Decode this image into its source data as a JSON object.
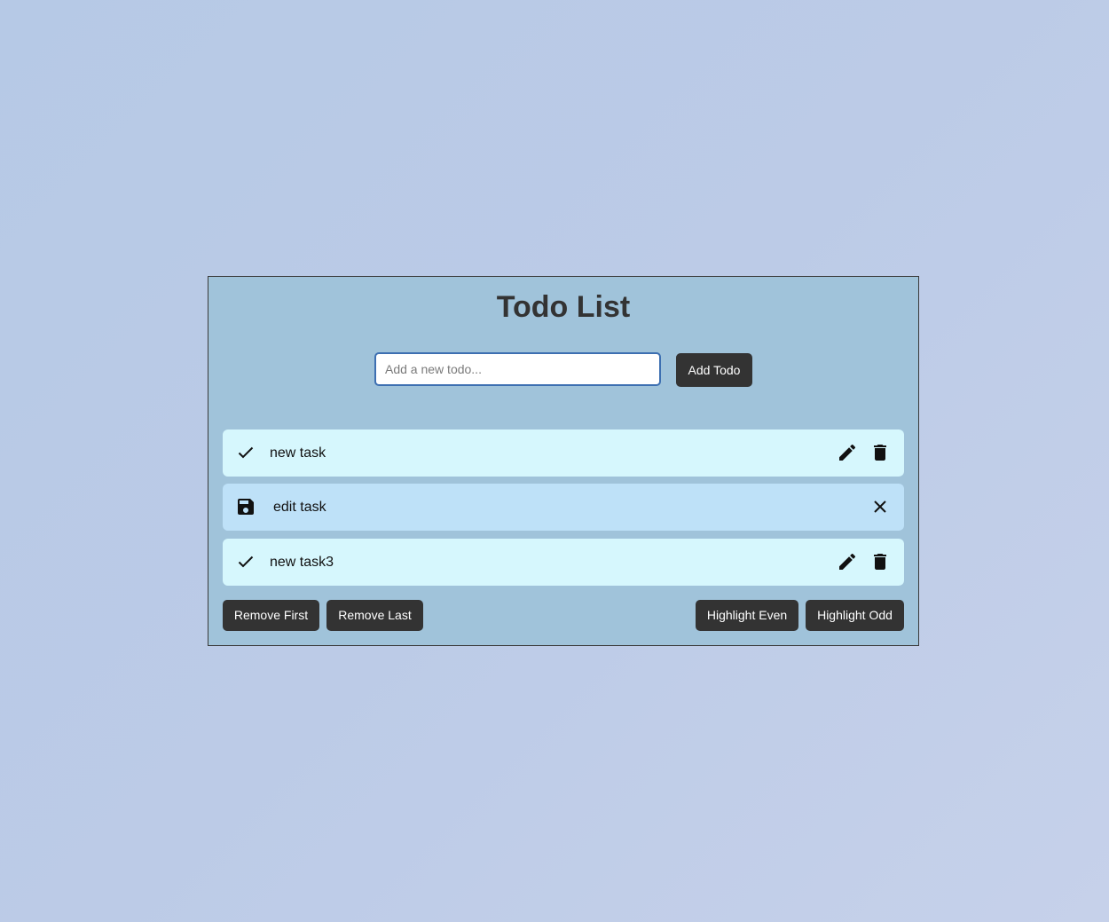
{
  "app": {
    "title": "Todo List"
  },
  "new_todo": {
    "placeholder": "Add a new todo...",
    "value": "",
    "add_label": "Add Todo"
  },
  "todos": [
    {
      "text": "new task",
      "mode": "view",
      "icons": [
        "check-icon",
        "pencil-icon",
        "trash-icon"
      ]
    },
    {
      "text": "edit task",
      "mode": "edit",
      "icons": [
        "save-icon",
        "close-icon"
      ]
    },
    {
      "text": "new task3",
      "mode": "view",
      "icons": [
        "check-icon",
        "pencil-icon",
        "trash-icon"
      ]
    }
  ],
  "actions": {
    "remove_first": "Remove First",
    "remove_last": "Remove Last",
    "highlight_even": "Highlight Even",
    "highlight_odd": "Highlight Odd"
  },
  "colors": {
    "panel": "#a0c3da",
    "item_normal": "#d6f7fd",
    "item_editing": "#bee1f8",
    "button": "#333333",
    "input_border": "#3d6fb1"
  }
}
